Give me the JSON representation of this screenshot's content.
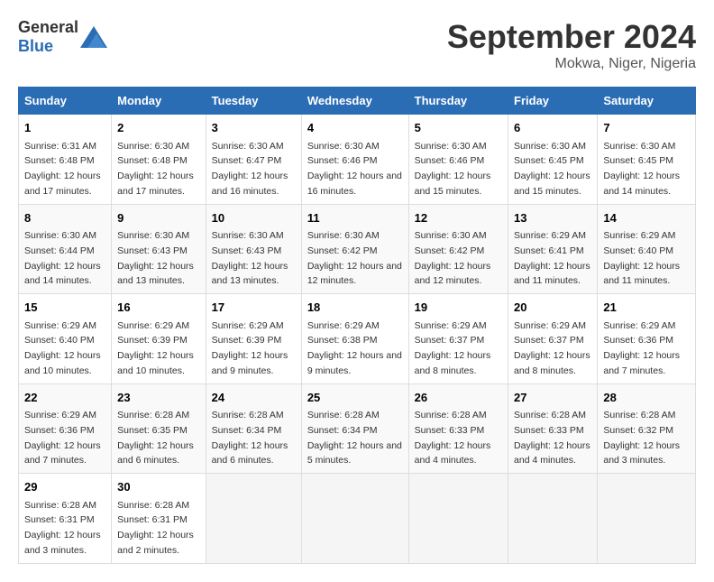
{
  "header": {
    "logo_general": "General",
    "logo_blue": "Blue",
    "month": "September 2024",
    "location": "Mokwa, Niger, Nigeria"
  },
  "columns": [
    "Sunday",
    "Monday",
    "Tuesday",
    "Wednesday",
    "Thursday",
    "Friday",
    "Saturday"
  ],
  "weeks": [
    [
      {
        "day": "1",
        "sunrise": "6:31 AM",
        "sunset": "6:48 PM",
        "daylight": "12 hours and 17 minutes."
      },
      {
        "day": "2",
        "sunrise": "6:30 AM",
        "sunset": "6:48 PM",
        "daylight": "12 hours and 17 minutes."
      },
      {
        "day": "3",
        "sunrise": "6:30 AM",
        "sunset": "6:47 PM",
        "daylight": "12 hours and 16 minutes."
      },
      {
        "day": "4",
        "sunrise": "6:30 AM",
        "sunset": "6:46 PM",
        "daylight": "12 hours and 16 minutes."
      },
      {
        "day": "5",
        "sunrise": "6:30 AM",
        "sunset": "6:46 PM",
        "daylight": "12 hours and 15 minutes."
      },
      {
        "day": "6",
        "sunrise": "6:30 AM",
        "sunset": "6:45 PM",
        "daylight": "12 hours and 15 minutes."
      },
      {
        "day": "7",
        "sunrise": "6:30 AM",
        "sunset": "6:45 PM",
        "daylight": "12 hours and 14 minutes."
      }
    ],
    [
      {
        "day": "8",
        "sunrise": "6:30 AM",
        "sunset": "6:44 PM",
        "daylight": "12 hours and 14 minutes."
      },
      {
        "day": "9",
        "sunrise": "6:30 AM",
        "sunset": "6:43 PM",
        "daylight": "12 hours and 13 minutes."
      },
      {
        "day": "10",
        "sunrise": "6:30 AM",
        "sunset": "6:43 PM",
        "daylight": "12 hours and 13 minutes."
      },
      {
        "day": "11",
        "sunrise": "6:30 AM",
        "sunset": "6:42 PM",
        "daylight": "12 hours and 12 minutes."
      },
      {
        "day": "12",
        "sunrise": "6:30 AM",
        "sunset": "6:42 PM",
        "daylight": "12 hours and 12 minutes."
      },
      {
        "day": "13",
        "sunrise": "6:29 AM",
        "sunset": "6:41 PM",
        "daylight": "12 hours and 11 minutes."
      },
      {
        "day": "14",
        "sunrise": "6:29 AM",
        "sunset": "6:40 PM",
        "daylight": "12 hours and 11 minutes."
      }
    ],
    [
      {
        "day": "15",
        "sunrise": "6:29 AM",
        "sunset": "6:40 PM",
        "daylight": "12 hours and 10 minutes."
      },
      {
        "day": "16",
        "sunrise": "6:29 AM",
        "sunset": "6:39 PM",
        "daylight": "12 hours and 10 minutes."
      },
      {
        "day": "17",
        "sunrise": "6:29 AM",
        "sunset": "6:39 PM",
        "daylight": "12 hours and 9 minutes."
      },
      {
        "day": "18",
        "sunrise": "6:29 AM",
        "sunset": "6:38 PM",
        "daylight": "12 hours and 9 minutes."
      },
      {
        "day": "19",
        "sunrise": "6:29 AM",
        "sunset": "6:37 PM",
        "daylight": "12 hours and 8 minutes."
      },
      {
        "day": "20",
        "sunrise": "6:29 AM",
        "sunset": "6:37 PM",
        "daylight": "12 hours and 8 minutes."
      },
      {
        "day": "21",
        "sunrise": "6:29 AM",
        "sunset": "6:36 PM",
        "daylight": "12 hours and 7 minutes."
      }
    ],
    [
      {
        "day": "22",
        "sunrise": "6:29 AM",
        "sunset": "6:36 PM",
        "daylight": "12 hours and 7 minutes."
      },
      {
        "day": "23",
        "sunrise": "6:28 AM",
        "sunset": "6:35 PM",
        "daylight": "12 hours and 6 minutes."
      },
      {
        "day": "24",
        "sunrise": "6:28 AM",
        "sunset": "6:34 PM",
        "daylight": "12 hours and 6 minutes."
      },
      {
        "day": "25",
        "sunrise": "6:28 AM",
        "sunset": "6:34 PM",
        "daylight": "12 hours and 5 minutes."
      },
      {
        "day": "26",
        "sunrise": "6:28 AM",
        "sunset": "6:33 PM",
        "daylight": "12 hours and 4 minutes."
      },
      {
        "day": "27",
        "sunrise": "6:28 AM",
        "sunset": "6:33 PM",
        "daylight": "12 hours and 4 minutes."
      },
      {
        "day": "28",
        "sunrise": "6:28 AM",
        "sunset": "6:32 PM",
        "daylight": "12 hours and 3 minutes."
      }
    ],
    [
      {
        "day": "29",
        "sunrise": "6:28 AM",
        "sunset": "6:31 PM",
        "daylight": "12 hours and 3 minutes."
      },
      {
        "day": "30",
        "sunrise": "6:28 AM",
        "sunset": "6:31 PM",
        "daylight": "12 hours and 2 minutes."
      },
      null,
      null,
      null,
      null,
      null
    ]
  ]
}
